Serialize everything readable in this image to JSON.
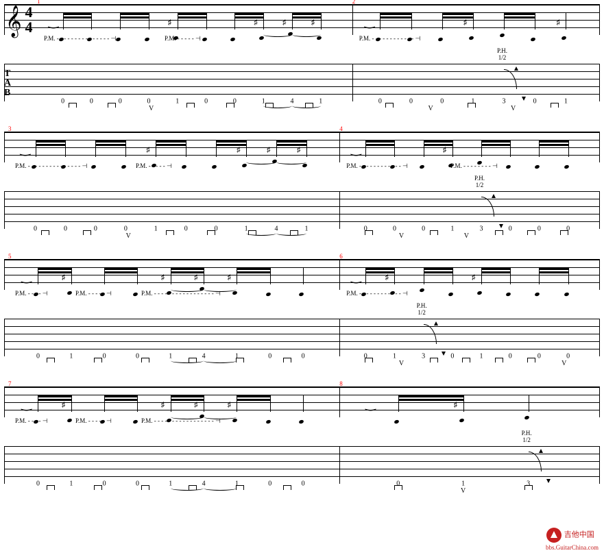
{
  "timeSignature": "4/4",
  "watermark": {
    "brand": "吉他中国",
    "url": "bbs.GuitarChina.com"
  },
  "tabTuning": [
    "T",
    "A",
    "B"
  ],
  "chart_data": {
    "type": "guitar-tab",
    "measures": [
      {
        "num": 1,
        "frets": [
          "0",
          "0",
          "0",
          "0",
          "1",
          "0",
          "0",
          "1",
          "4",
          "1"
        ],
        "string": 6,
        "pm": [
          {
            "label": "P.M.",
            "span": "- - - - - - - - - - - - - - -"
          },
          {
            "label": "P.M.",
            "span": "- - - - -"
          }
        ],
        "picking": [
          "d",
          "d",
          "u",
          "d",
          "d",
          "d",
          "d"
        ],
        "ties": [
          [
            7,
            8
          ],
          [
            8,
            9
          ]
        ]
      },
      {
        "num": 2,
        "frets": [
          "0",
          "0",
          "0",
          "1",
          "3",
          "0",
          "1"
        ],
        "string": 6,
        "pm": [
          {
            "label": "P.M.",
            "span": "- - - - - - - - - - - -"
          }
        ],
        "ph": {
          "label": "P.H.",
          "bend": "1/2",
          "at": 4
        },
        "picking": [
          "d",
          "u",
          "d",
          "u",
          "d"
        ]
      },
      {
        "num": 3,
        "frets": [
          "0",
          "0",
          "0",
          "0",
          "1",
          "0",
          "0",
          "1",
          "4",
          "1"
        ],
        "string": 6,
        "pm": [
          {
            "label": "P.M.",
            "span": "- - - - - - - - - - - - - - -"
          },
          {
            "label": "P.M.",
            "span": "- - - - -"
          }
        ],
        "picking": [
          "d",
          "d",
          "u",
          "d",
          "d",
          "d",
          "d"
        ],
        "ties": [
          [
            7,
            8
          ],
          [
            8,
            9
          ]
        ]
      },
      {
        "num": 4,
        "frets": [
          "0",
          "0",
          "0",
          "1",
          "3",
          "0",
          "0",
          "0"
        ],
        "string": 6,
        "pm": [
          {
            "label": "P.M.",
            "span": "- - - - - - - - - - - -"
          },
          {
            "label": "P.M.",
            "span": "- - - - - - - -"
          }
        ],
        "ph": {
          "label": "P.H.",
          "bend": "1/2",
          "at": 4
        },
        "picking": [
          "d",
          "u",
          "d",
          "u",
          "d",
          "d",
          "d"
        ]
      },
      {
        "num": 5,
        "frets": [
          "0",
          "1",
          "0",
          "0",
          "1",
          "4",
          "1",
          "0",
          "0"
        ],
        "string": 6,
        "pm": [
          {
            "label": "P.M.",
            "span": "- - - -"
          },
          {
            "label": "P.M.",
            "span": "- - - - -"
          },
          {
            "label": "P.M.",
            "span": "- - - - - - - - - - - - - - - - -"
          }
        ],
        "picking": [
          "d",
          "d",
          "d",
          "d",
          "d",
          "d"
        ],
        "ties": [
          [
            4,
            5
          ],
          [
            5,
            6
          ]
        ]
      },
      {
        "num": 6,
        "frets": [
          "0",
          "1",
          "3",
          "0",
          "1",
          "0",
          "0",
          "0"
        ],
        "string": 6,
        "pm": [
          {
            "label": "P.M.",
            "span": "- - - - - - - - - - - -"
          }
        ],
        "ph": {
          "label": "P.H.",
          "bend": "1/2",
          "at": 2
        },
        "picking": [
          "d",
          "u",
          "d",
          "d",
          "d",
          "d",
          "u"
        ]
      },
      {
        "num": 7,
        "frets": [
          "0",
          "1",
          "0",
          "0",
          "1",
          "4",
          "1",
          "0",
          "0"
        ],
        "string": 6,
        "pm": [
          {
            "label": "P.M.",
            "span": "- - - -"
          },
          {
            "label": "P.M.",
            "span": "- - - - -"
          },
          {
            "label": "P.M.",
            "span": "- - - - - - - - - - - - - - - - -"
          }
        ],
        "picking": [
          "d",
          "d",
          "d",
          "d",
          "d",
          "d"
        ],
        "ties": [
          [
            4,
            5
          ],
          [
            5,
            6
          ]
        ]
      },
      {
        "num": 8,
        "frets": [
          "0",
          "1",
          "3"
        ],
        "string": 6,
        "pm": [],
        "ph": {
          "label": "P.H.",
          "bend": "1/2",
          "at": 2
        },
        "picking": [
          "d",
          "u",
          "d"
        ]
      }
    ]
  }
}
